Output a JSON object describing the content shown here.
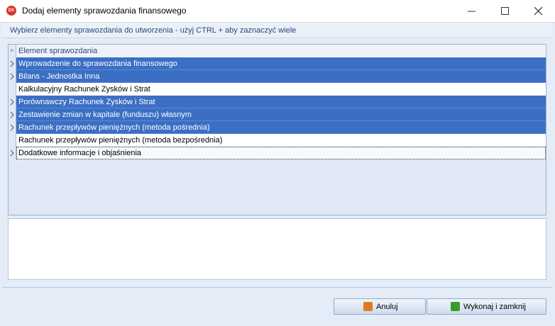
{
  "window": {
    "title": "Dodaj elementy sprawozdania finansowego",
    "app_icon_text": "DX"
  },
  "instruction": "Wybierz elementy sprawozdania do utworzenia - użyj CTRL + aby zaznaczyć wiele",
  "grid": {
    "column_header": "Element sprawozdania",
    "rows": [
      {
        "label": "Wprowadzenie do sprawozdania finansowego",
        "selected": true,
        "expandable": true
      },
      {
        "label": "Bilans - Jednostka Inna",
        "selected": true,
        "expandable": true
      },
      {
        "label": "Kalkulacyjny Rachunek Zysków i Strat",
        "selected": false,
        "expandable": false
      },
      {
        "label": "Porównawczy Rachunek Zysków i Strat",
        "selected": true,
        "expandable": true
      },
      {
        "label": "Zestawienie zmian w kapitale (funduszu) własnym",
        "selected": true,
        "expandable": true
      },
      {
        "label": "Rachunek przepływów pieniężnych (metoda pośrednia)",
        "selected": true,
        "expandable": true
      },
      {
        "label": "Rachunek przepływów pieniężnych (metoda bezpośrednia)",
        "selected": false,
        "expandable": false
      },
      {
        "label": "Dodatkowe informacje i objaśnienia",
        "selected": false,
        "expandable": true,
        "focused": true
      }
    ]
  },
  "description": "",
  "buttons": {
    "cancel": {
      "label": "Anuluj",
      "icon": "cancel-icon",
      "icon_color": "#e07b1e"
    },
    "ok": {
      "label": "Wykonaj i zamknij",
      "icon": "arrow-right-icon",
      "icon_color": "#3c9a2d"
    }
  },
  "colors": {
    "selected_row": "#3b6fc4",
    "title_text": "#2a4a7f"
  }
}
